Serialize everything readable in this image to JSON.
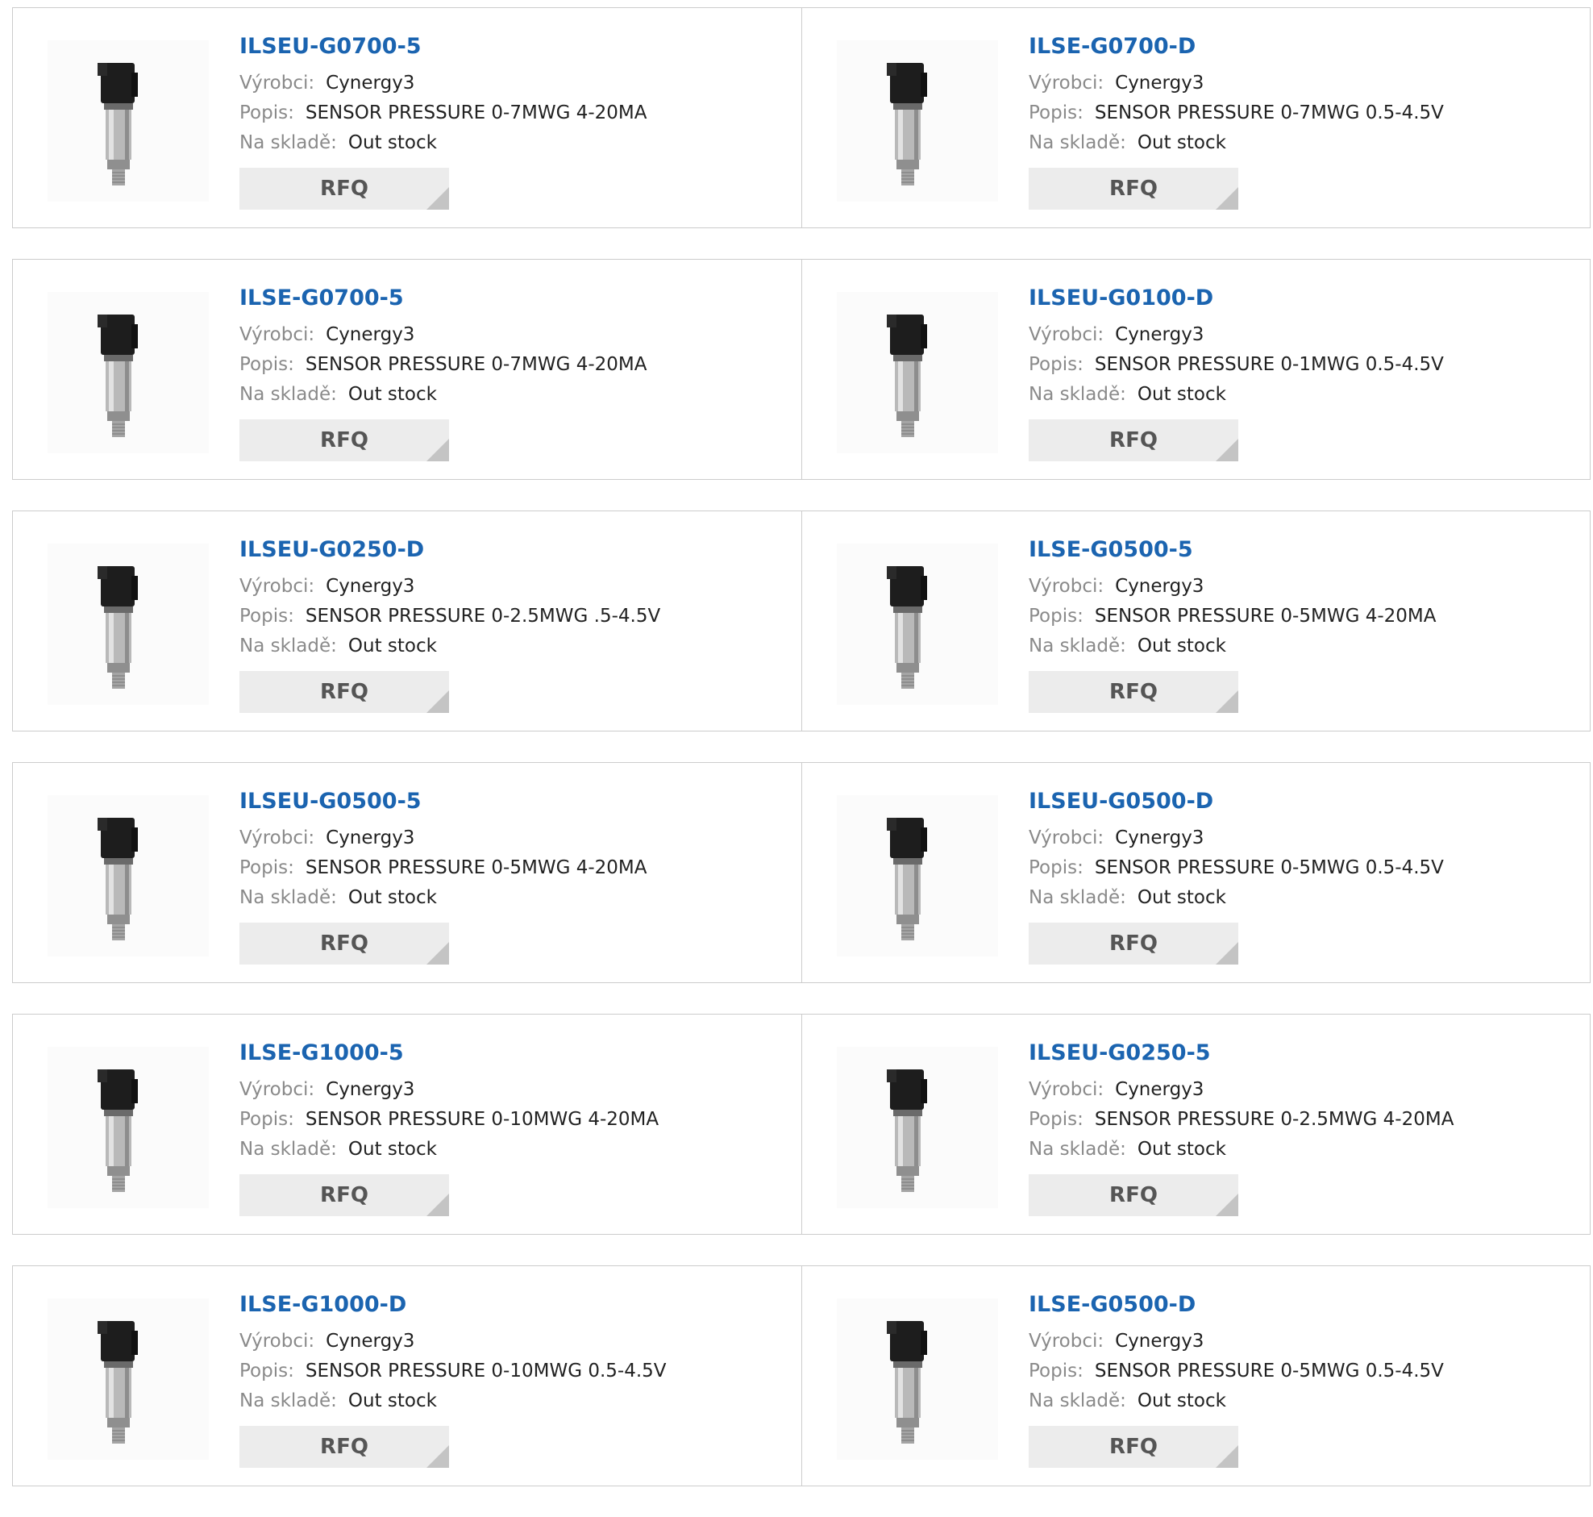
{
  "labels": {
    "manufacturer": "Výrobci:",
    "description": "Popis:",
    "stock": "Na skladě:",
    "rfq": "RFQ"
  },
  "products": [
    {
      "pn": "ILSEU-G0700-5",
      "manufacturer": "Cynergy3",
      "description": "SENSOR PRESSURE 0-7MWG 4-20MA",
      "stock": "Out stock"
    },
    {
      "pn": "ILSE-G0700-D",
      "manufacturer": "Cynergy3",
      "description": "SENSOR PRESSURE 0-7MWG 0.5-4.5V",
      "stock": "Out stock"
    },
    {
      "pn": "ILSE-G0700-5",
      "manufacturer": "Cynergy3",
      "description": "SENSOR PRESSURE 0-7MWG 4-20MA",
      "stock": "Out stock"
    },
    {
      "pn": "ILSEU-G0100-D",
      "manufacturer": "Cynergy3",
      "description": "SENSOR PRESSURE 0-1MWG 0.5-4.5V",
      "stock": "Out stock"
    },
    {
      "pn": "ILSEU-G0250-D",
      "manufacturer": "Cynergy3",
      "description": "SENSOR PRESSURE 0-2.5MWG .5-4.5V",
      "stock": "Out stock"
    },
    {
      "pn": "ILSE-G0500-5",
      "manufacturer": "Cynergy3",
      "description": "SENSOR PRESSURE 0-5MWG 4-20MA",
      "stock": "Out stock"
    },
    {
      "pn": "ILSEU-G0500-5",
      "manufacturer": "Cynergy3",
      "description": "SENSOR PRESSURE 0-5MWG 4-20MA",
      "stock": "Out stock"
    },
    {
      "pn": "ILSEU-G0500-D",
      "manufacturer": "Cynergy3",
      "description": "SENSOR PRESSURE 0-5MWG 0.5-4.5V",
      "stock": "Out stock"
    },
    {
      "pn": "ILSE-G1000-5",
      "manufacturer": "Cynergy3",
      "description": "SENSOR PRESSURE 0-10MWG 4-20MA",
      "stock": "Out stock"
    },
    {
      "pn": "ILSEU-G0250-5",
      "manufacturer": "Cynergy3",
      "description": "SENSOR PRESSURE 0-2.5MWG 4-20MA",
      "stock": "Out stock"
    },
    {
      "pn": "ILSE-G1000-D",
      "manufacturer": "Cynergy3",
      "description": "SENSOR PRESSURE 0-10MWG 0.5-4.5V",
      "stock": "Out stock"
    },
    {
      "pn": "ILSE-G0500-D",
      "manufacturer": "Cynergy3",
      "description": "SENSOR PRESSURE 0-5MWG 0.5-4.5V",
      "stock": "Out stock"
    }
  ],
  "colors": {
    "part_number": "#1b64b0",
    "label": "#8a8a8a",
    "value": "#222222",
    "rfq_bg": "#ececec",
    "border": "#cccccc"
  },
  "icons": {
    "thumbnail": "pressure-sensor-photo",
    "rfq_corner": "corner-triangle-icon"
  }
}
